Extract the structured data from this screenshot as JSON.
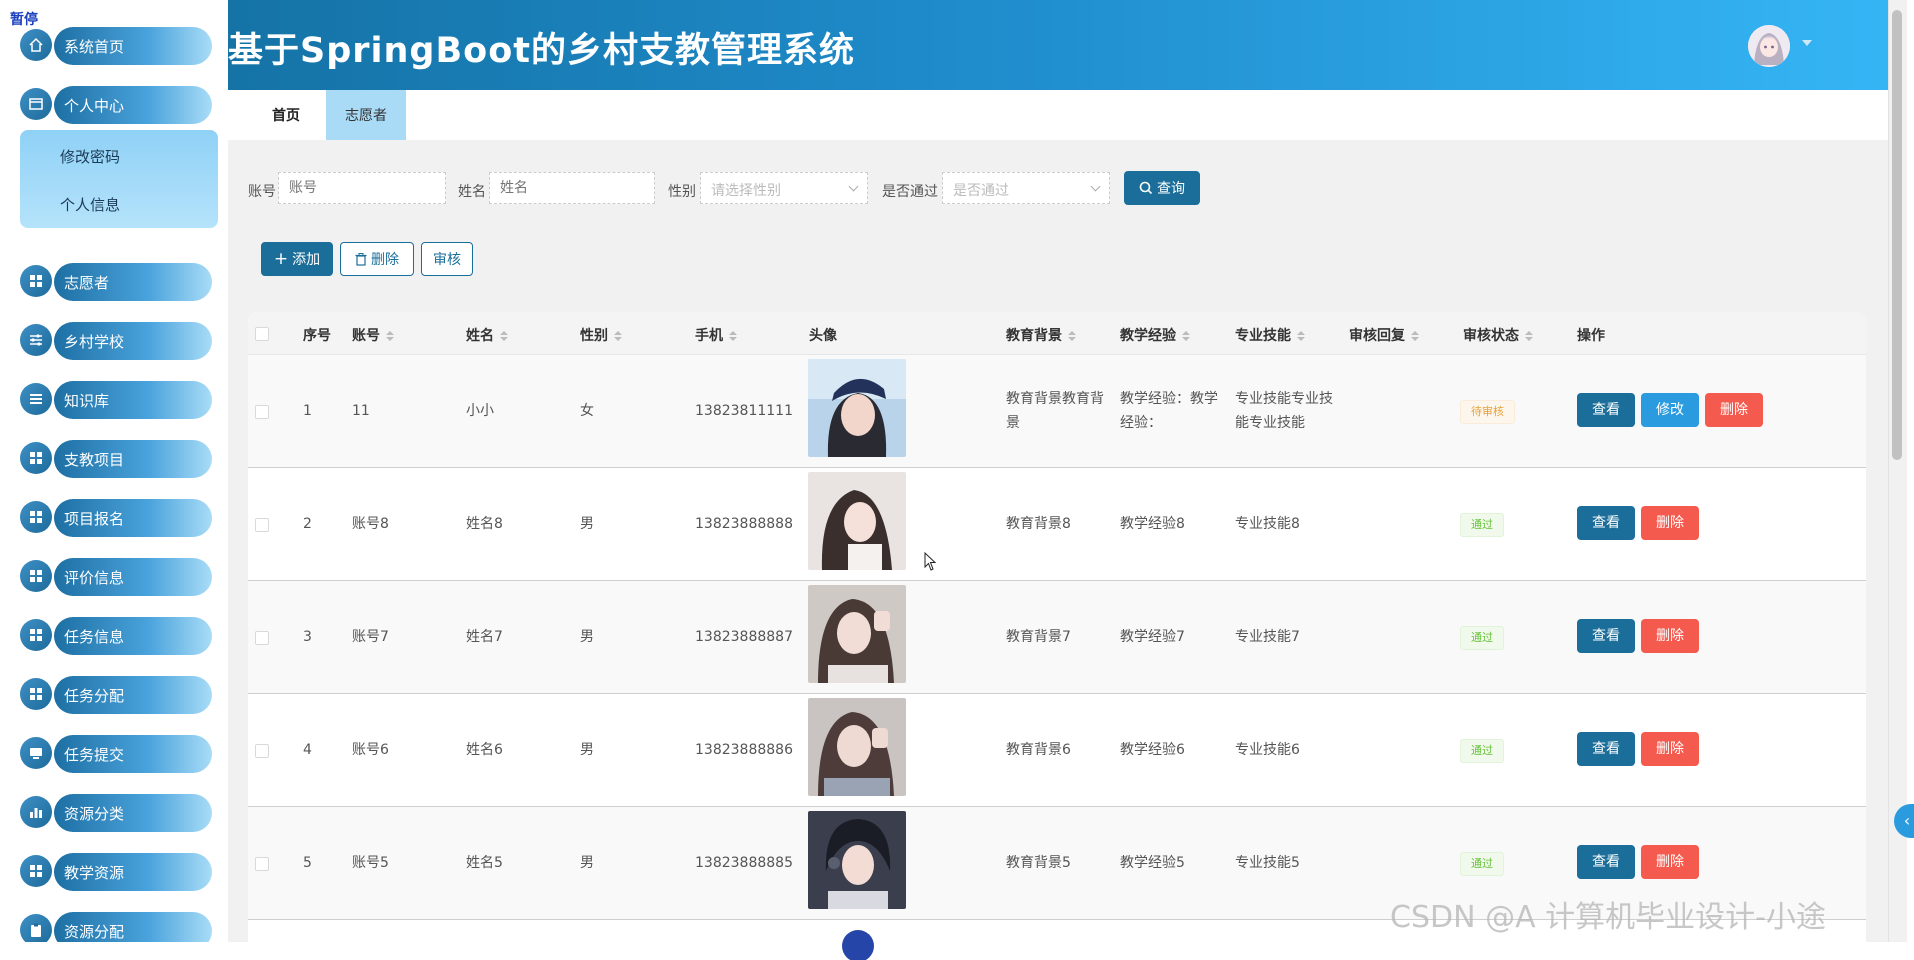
{
  "paused_label": "暂停",
  "sidebar": {
    "items": [
      {
        "label": "系统首页",
        "icon": "home-icon"
      },
      {
        "label": "个人中心",
        "icon": "window-icon"
      },
      {
        "label": "志愿者",
        "icon": "grid-icon"
      },
      {
        "label": "乡村学校",
        "icon": "sliders-icon"
      },
      {
        "label": "知识库",
        "icon": "list-icon"
      },
      {
        "label": "支教项目",
        "icon": "grid-icon"
      },
      {
        "label": "项目报名",
        "icon": "grid-icon"
      },
      {
        "label": "评价信息",
        "icon": "grid-icon"
      },
      {
        "label": "任务信息",
        "icon": "grid-icon"
      },
      {
        "label": "任务分配",
        "icon": "grid-icon"
      },
      {
        "label": "任务提交",
        "icon": "monitor-icon"
      },
      {
        "label": "资源分类",
        "icon": "bar-chart-icon"
      },
      {
        "label": "教学资源",
        "icon": "grid-icon"
      },
      {
        "label": "资源分配",
        "icon": "clipboard-icon"
      }
    ],
    "submenu": [
      "修改密码",
      "个人信息"
    ]
  },
  "header": {
    "title": "基于SpringBoot的乡村支教管理系统"
  },
  "tabs": {
    "home": "首页",
    "volunteer": "志愿者"
  },
  "search": {
    "account_label": "账号",
    "account_placeholder": "账号",
    "name_label": "姓名",
    "name_placeholder": "姓名",
    "gender_label": "性别",
    "gender_placeholder": "请选择性别",
    "pass_label": "是否通过",
    "pass_placeholder": "是否通过",
    "query_button": "查询"
  },
  "toolbar": {
    "add": "添加",
    "delete": "删除",
    "audit": "审核"
  },
  "table": {
    "headers": {
      "index": "序号",
      "account": "账号",
      "name": "姓名",
      "gender": "性别",
      "phone": "手机",
      "avatar": "头像",
      "education": "教育背景",
      "experience": "教学经验",
      "skills": "专业技能",
      "reply": "审核回复",
      "status": "审核状态",
      "actions": "操作"
    },
    "rows": [
      {
        "index": "1",
        "account": "11",
        "name": "小小",
        "gender": "女",
        "phone": "13823811111",
        "education": "教育背景教育背景",
        "experience": "教学经验：教学经验：",
        "skills": "专业技能专业技能专业技能",
        "reply": "",
        "status": "待审核",
        "status_kind": "pending"
      },
      {
        "index": "2",
        "account": "账号8",
        "name": "姓名8",
        "gender": "男",
        "phone": "13823888888",
        "education": "教育背景8",
        "experience": "教学经验8",
        "skills": "专业技能8",
        "reply": "",
        "status": "通过",
        "status_kind": "pass"
      },
      {
        "index": "3",
        "account": "账号7",
        "name": "姓名7",
        "gender": "男",
        "phone": "13823888887",
        "education": "教育背景7",
        "experience": "教学经验7",
        "skills": "专业技能7",
        "reply": "",
        "status": "通过",
        "status_kind": "pass"
      },
      {
        "index": "4",
        "account": "账号6",
        "name": "姓名6",
        "gender": "男",
        "phone": "13823888886",
        "education": "教育背景6",
        "experience": "教学经验6",
        "skills": "专业技能6",
        "reply": "",
        "status": "通过",
        "status_kind": "pass"
      },
      {
        "index": "5",
        "account": "账号5",
        "name": "姓名5",
        "gender": "男",
        "phone": "13823888885",
        "education": "教育背景5",
        "experience": "教学经验5",
        "skills": "专业技能5",
        "reply": "",
        "status": "通过",
        "status_kind": "pass"
      }
    ],
    "action_labels": {
      "view": "查看",
      "edit": "修改",
      "delete": "删除"
    }
  },
  "watermark": "CSDN @A 计算机毕业设计-小途",
  "colors": {
    "primary": "#1a6e99",
    "accent": "#2b9be0",
    "danger": "#f55a4e",
    "header_start": "#1573a6",
    "header_end": "#35b5f5"
  }
}
